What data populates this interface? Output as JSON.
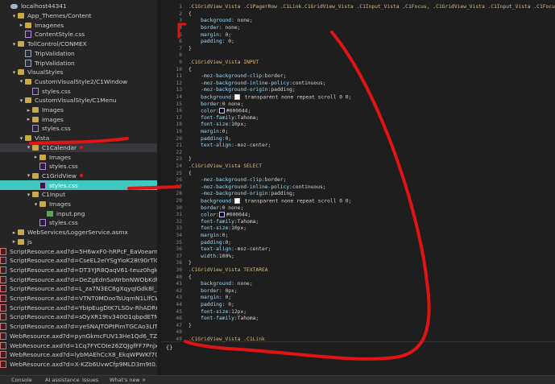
{
  "tree": {
    "items": [
      {
        "label": "localhost44341",
        "indent": 0,
        "chev": "",
        "icon": "cloud"
      },
      {
        "label": "App_Themes/Content",
        "indent": 1,
        "chev": "▾",
        "icon": "folder"
      },
      {
        "label": "Imagenes",
        "indent": 2,
        "chev": "▸",
        "icon": "folder"
      },
      {
        "label": "ContentStyle.css",
        "indent": 2,
        "chev": "",
        "icon": "css"
      },
      {
        "label": "TollControl/CONMEX",
        "indent": 1,
        "chev": "▾",
        "icon": "folder"
      },
      {
        "label": "TripValidation",
        "indent": 2,
        "chev": "",
        "icon": "gen"
      },
      {
        "label": "TripValidation",
        "indent": 2,
        "chev": "",
        "icon": "gen"
      },
      {
        "label": "VisualStyles",
        "indent": 1,
        "chev": "▾",
        "icon": "folder"
      },
      {
        "label": "CustomVisualStyle2/C1Window",
        "indent": 2,
        "chev": "▾",
        "icon": "folder"
      },
      {
        "label": "styles.css",
        "indent": 3,
        "chev": "",
        "icon": "css"
      },
      {
        "label": "CustomVisualStyle/C1Menu",
        "indent": 2,
        "chev": "▾",
        "icon": "folder"
      },
      {
        "label": "Images",
        "indent": 3,
        "chev": "▸",
        "icon": "folder"
      },
      {
        "label": "images",
        "indent": 3,
        "chev": "▸",
        "icon": "folder"
      },
      {
        "label": "styles.css",
        "indent": 3,
        "chev": "",
        "icon": "css"
      },
      {
        "label": "Vista",
        "indent": 2,
        "chev": "▾",
        "icon": "folder"
      },
      {
        "label": "C1Calendar",
        "indent": 3,
        "chev": "▾",
        "icon": "folder",
        "dot": true,
        "hov": true
      },
      {
        "label": "Images",
        "indent": 4,
        "chev": "▸",
        "icon": "folder"
      },
      {
        "label": "styles.css",
        "indent": 4,
        "chev": "",
        "icon": "css"
      },
      {
        "label": "C1GridView",
        "indent": 3,
        "chev": "▾",
        "icon": "folder",
        "dot": true
      },
      {
        "label": "styles.css",
        "indent": 4,
        "chev": "",
        "icon": "css",
        "sel": true
      },
      {
        "label": "C1Input",
        "indent": 3,
        "chev": "▾",
        "icon": "folder"
      },
      {
        "label": "Images",
        "indent": 4,
        "chev": "▾",
        "icon": "folder"
      },
      {
        "label": "input.png",
        "indent": 5,
        "chev": "",
        "icon": "img"
      },
      {
        "label": "styles.css",
        "indent": 4,
        "chev": "",
        "icon": "css"
      },
      {
        "label": "WebServices/LoggerService.asmx",
        "indent": 1,
        "chev": "▸",
        "icon": "folder"
      },
      {
        "label": "js",
        "indent": 1,
        "chev": "▸",
        "icon": "folder"
      },
      {
        "label": "ScriptResource.axd?d=5H6wxF0-hRPcF_EaVoeamBo...",
        "indent": 1,
        "chev": "",
        "icon": "rs"
      },
      {
        "label": "ScriptResource.axd?d=CseEL2eIYSgYioK28t90rTl01...",
        "indent": 1,
        "chev": "",
        "icon": "rs"
      },
      {
        "label": "ScriptResource.axd?d=DT3YJR8QaqV61-teuz0hgkX...",
        "indent": 1,
        "chev": "",
        "icon": "rs"
      },
      {
        "label": "ScriptResource.axd?d=DeZgEdnSaWrbnNWObKdt...",
        "indent": 1,
        "chev": "",
        "icon": "rs"
      },
      {
        "label": "ScriptResource.axd?d=L_za7N3EC8gXqyqIGdk8l_T...",
        "indent": 1,
        "chev": "",
        "icon": "rs"
      },
      {
        "label": "ScriptResource.axd?d=VTNT0MDooTsUqmN1LlfCW...",
        "indent": 1,
        "chev": "",
        "icon": "rs"
      },
      {
        "label": "ScriptResource.axd?d=YbIpEugDtK7LSGv-RhADR6S...",
        "indent": 1,
        "chev": "",
        "icon": "rs"
      },
      {
        "label": "ScriptResource.axd?d=sOyXR19tv340O1qbpdETMD...",
        "indent": 1,
        "chev": "",
        "icon": "rs"
      },
      {
        "label": "ScriptResource.axd?d=yeSNAJTOPtPimTGCAo3LIT3...",
        "indent": 1,
        "chev": "",
        "icon": "rs"
      },
      {
        "label": "WebResource.axd?d=pynGkmcFUV13He1Qd6_TZD...",
        "indent": 1,
        "chev": "",
        "icon": "rs"
      },
      {
        "label": "WebResource.axd?d=1Cq7FYCOIe26ZQJgfFF7Pnjx-...",
        "indent": 1,
        "chev": "",
        "icon": "rs"
      },
      {
        "label": "WebResource.axd?d=lybMAEhCcX8_EkqWPWKf701...",
        "indent": 1,
        "chev": "",
        "icon": "rs"
      },
      {
        "label": "WebResource.axd?d=X-KZb6UvwCfp9MLD3m9t0...",
        "indent": 1,
        "chev": "",
        "icon": "rs"
      }
    ]
  },
  "bottom_tabs": [
    "Console",
    "AI assistance",
    "Issues",
    "What's new ×"
  ],
  "editor": {
    "footer": "{}",
    "lines": [
      {
        "n": "1",
        "t": [
          [
            ".C1GridView_Vista .C1PagerRow .C1Link.C1GridView_Vista .C1Input_Vista .C1Focus, .C1GridView_Vista .C1Input_Vista .C1Focus .C1Tex",
            "sel-c"
          ]
        ]
      },
      {
        "n": "2",
        "t": [
          [
            "{",
            "brace"
          ]
        ]
      },
      {
        "n": "3",
        "t": [
          [
            "    background",
            "prop"
          ],
          [
            ": none;",
            "code"
          ]
        ]
      },
      {
        "n": "4",
        "t": [
          [
            "    border",
            "prop"
          ],
          [
            ": none;",
            "code"
          ]
        ]
      },
      {
        "n": "5",
        "t": [
          [
            "    margin",
            "prop"
          ],
          [
            ": 0;",
            "code"
          ]
        ]
      },
      {
        "n": "6",
        "t": [
          [
            "    padding",
            "prop"
          ],
          [
            ": 0;",
            "code"
          ]
        ]
      },
      {
        "n": "7",
        "t": [
          [
            "}",
            "brace"
          ]
        ]
      },
      {
        "n": "8",
        "t": [
          [
            "",
            "code"
          ]
        ]
      },
      {
        "n": "9",
        "t": [
          [
            ".C1GridView_Vista INPUT",
            "sel-c"
          ]
        ]
      },
      {
        "n": "10",
        "t": [
          [
            "{",
            "brace"
          ]
        ]
      },
      {
        "n": "11",
        "t": [
          [
            "    -moz-background-clip",
            "prop"
          ],
          [
            ":border;",
            "code"
          ]
        ]
      },
      {
        "n": "12",
        "t": [
          [
            "    -moz-background-inline-policy",
            "prop"
          ],
          [
            ":continuous;",
            "code"
          ]
        ]
      },
      {
        "n": "13",
        "t": [
          [
            "    -moz-background-origin",
            "prop"
          ],
          [
            ":padding;",
            "code"
          ]
        ]
      },
      {
        "n": "14",
        "t": [
          [
            "    background",
            "prop"
          ],
          [
            ":",
            "code"
          ],
          [
            "SW:transparent",
            "code"
          ],
          [
            " transparent none repeat scroll 0 0;",
            "code"
          ]
        ]
      },
      {
        "n": "15",
        "t": [
          [
            "    border",
            "prop"
          ],
          [
            ":0 none;",
            "code"
          ]
        ]
      },
      {
        "n": "16",
        "t": [
          [
            "    color",
            "prop"
          ],
          [
            ":",
            "code"
          ],
          [
            "SW:#000044",
            "code"
          ],
          [
            "#000044;",
            "code"
          ]
        ]
      },
      {
        "n": "17",
        "t": [
          [
            "    font-family",
            "prop"
          ],
          [
            ":Tahoma;",
            "code"
          ]
        ]
      },
      {
        "n": "18",
        "t": [
          [
            "    font-size",
            "prop"
          ],
          [
            ":10px;",
            "code"
          ]
        ]
      },
      {
        "n": "19",
        "t": [
          [
            "    margin",
            "prop"
          ],
          [
            ":0;",
            "code"
          ]
        ]
      },
      {
        "n": "20",
        "t": [
          [
            "    padding",
            "prop"
          ],
          [
            ":0;",
            "code"
          ]
        ]
      },
      {
        "n": "21",
        "t": [
          [
            "    text-align",
            "prop"
          ],
          [
            ":-moz-center;",
            "code"
          ]
        ]
      },
      {
        "n": "22",
        "t": [
          [
            "",
            "code"
          ]
        ]
      },
      {
        "n": "23",
        "t": [
          [
            "}",
            "brace"
          ]
        ]
      },
      {
        "n": "24",
        "t": [
          [
            ".C1GridView_Vista SELECT",
            "sel-c"
          ]
        ]
      },
      {
        "n": "25",
        "t": [
          [
            "{",
            "brace"
          ]
        ]
      },
      {
        "n": "26",
        "t": [
          [
            "    -moz-background-clip",
            "prop"
          ],
          [
            ":border;",
            "code"
          ]
        ]
      },
      {
        "n": "27",
        "t": [
          [
            "    -moz-background-inline-policy",
            "prop"
          ],
          [
            ":continuous;",
            "code"
          ]
        ]
      },
      {
        "n": "28",
        "t": [
          [
            "    -moz-background-origin",
            "prop"
          ],
          [
            ":padding;",
            "code"
          ]
        ]
      },
      {
        "n": "29",
        "t": [
          [
            "    background",
            "prop"
          ],
          [
            ":",
            "code"
          ],
          [
            "SW:transparent",
            "code"
          ],
          [
            " transparent none repeat scroll 0 0;",
            "code"
          ]
        ]
      },
      {
        "n": "30",
        "t": [
          [
            "    border",
            "prop"
          ],
          [
            ":0 none;",
            "code"
          ]
        ]
      },
      {
        "n": "31",
        "t": [
          [
            "    color",
            "prop"
          ],
          [
            ":",
            "code"
          ],
          [
            "SW:#000044",
            "code"
          ],
          [
            "#000044;",
            "code"
          ]
        ]
      },
      {
        "n": "32",
        "t": [
          [
            "    font-family",
            "prop"
          ],
          [
            ":Tahoma;",
            "code"
          ]
        ]
      },
      {
        "n": "33",
        "t": [
          [
            "    font-size",
            "prop"
          ],
          [
            ":10px;",
            "code"
          ]
        ]
      },
      {
        "n": "34",
        "t": [
          [
            "    margin",
            "prop"
          ],
          [
            ":0;",
            "code"
          ]
        ]
      },
      {
        "n": "35",
        "t": [
          [
            "    padding",
            "prop"
          ],
          [
            ":0;",
            "code"
          ]
        ]
      },
      {
        "n": "36",
        "t": [
          [
            "    text-align",
            "prop"
          ],
          [
            ":-moz-center;",
            "code"
          ]
        ]
      },
      {
        "n": "37",
        "t": [
          [
            "    width",
            "prop"
          ],
          [
            ":100%;",
            "code"
          ]
        ]
      },
      {
        "n": "38",
        "t": [
          [
            "}",
            "brace"
          ]
        ]
      },
      {
        "n": "39",
        "t": [
          [
            ".C1GridView_Vista TEXTAREA",
            "sel-c"
          ]
        ]
      },
      {
        "n": "40",
        "t": [
          [
            "{",
            "brace"
          ]
        ]
      },
      {
        "n": "41",
        "t": [
          [
            "    background",
            "prop"
          ],
          [
            ": none;",
            "code"
          ]
        ]
      },
      {
        "n": "42",
        "t": [
          [
            "    border",
            "prop"
          ],
          [
            ": 0px;",
            "code"
          ]
        ]
      },
      {
        "n": "43",
        "t": [
          [
            "    margin",
            "prop"
          ],
          [
            ": 0;",
            "code"
          ]
        ]
      },
      {
        "n": "44",
        "t": [
          [
            "    padding",
            "prop"
          ],
          [
            ": 0;",
            "code"
          ]
        ]
      },
      {
        "n": "45",
        "t": [
          [
            "    font-size",
            "prop"
          ],
          [
            ":12px;",
            "code"
          ]
        ]
      },
      {
        "n": "46",
        "t": [
          [
            "    font-family",
            "prop"
          ],
          [
            ":Tahoma;",
            "code"
          ]
        ]
      },
      {
        "n": "47",
        "t": [
          [
            "}",
            "brace"
          ]
        ]
      },
      {
        "n": "48",
        "t": [
          [
            "",
            "code"
          ]
        ]
      },
      {
        "n": "49",
        "t": [
          [
            ".C1GridView_Vista .C1Link",
            "sel-c"
          ]
        ]
      }
    ]
  },
  "colors": {
    "accent": "#3ec8c0",
    "annotation": "#e01414",
    "selector": "#d7ba7d",
    "property": "#9cdcfe"
  }
}
